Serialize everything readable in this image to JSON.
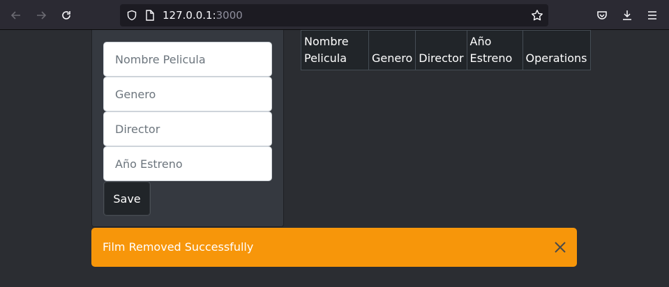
{
  "browser": {
    "url_host": "127.0.0.1:",
    "url_port": "3000"
  },
  "form": {
    "fields": [
      {
        "placeholder": "Nombre Pelicula",
        "value": ""
      },
      {
        "placeholder": "Genero",
        "value": ""
      },
      {
        "placeholder": "Director",
        "value": ""
      },
      {
        "placeholder": "Año Estreno",
        "value": ""
      }
    ],
    "save_label": "Save"
  },
  "table": {
    "headers": [
      "Nombre Pelicula",
      "Genero",
      "Director",
      "Año Estreno",
      "Operations"
    ]
  },
  "alert": {
    "message": "Film Removed Successfully",
    "color": "#f7960a"
  }
}
